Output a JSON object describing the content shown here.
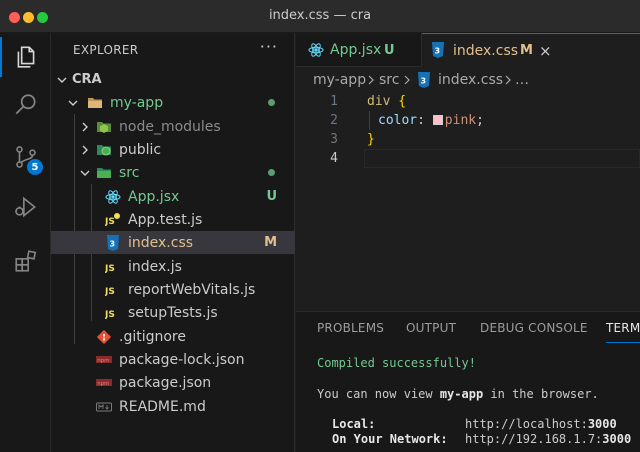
{
  "window": {
    "title": "index.css — cra"
  },
  "activity_bar": {
    "items": [
      {
        "name": "explorer",
        "icon": "files-icon",
        "active": true
      },
      {
        "name": "search",
        "icon": "search-icon"
      },
      {
        "name": "source-control",
        "icon": "source-control-icon",
        "badge": "5"
      },
      {
        "name": "run-debug",
        "icon": "debug-icon"
      },
      {
        "name": "extensions",
        "icon": "extensions-icon"
      }
    ]
  },
  "explorer": {
    "header": "EXPLORER",
    "more": "···",
    "workspace": "CRA",
    "tree": [
      {
        "label": "my-app",
        "icon": "folder-icon",
        "depth": 1,
        "expanded": true,
        "status": "dot"
      },
      {
        "label": "node_modules",
        "icon": "node-folder-icon",
        "depth": 2,
        "expanded": false
      },
      {
        "label": "public",
        "icon": "public-folder-icon",
        "depth": 2,
        "expanded": false
      },
      {
        "label": "src",
        "icon": "src-folder-icon",
        "depth": 2,
        "expanded": true,
        "status": "dot"
      },
      {
        "label": "App.jsx",
        "icon": "react-icon",
        "depth": 3,
        "status": "U"
      },
      {
        "label": "App.test.js",
        "icon": "js-test-icon",
        "depth": 3
      },
      {
        "label": "index.css",
        "icon": "css-icon",
        "depth": 3,
        "status": "M",
        "selected": true
      },
      {
        "label": "index.js",
        "icon": "js-icon",
        "depth": 3
      },
      {
        "label": "reportWebVitals.js",
        "icon": "js-icon",
        "depth": 3
      },
      {
        "label": "setupTests.js",
        "icon": "js-icon",
        "depth": 3
      },
      {
        "label": ".gitignore",
        "icon": "git-icon",
        "depth": 2
      },
      {
        "label": "package-lock.json",
        "icon": "npm-icon",
        "depth": 2
      },
      {
        "label": "package.json",
        "icon": "npm-icon",
        "depth": 2
      },
      {
        "label": "README.md",
        "icon": "markdown-icon",
        "depth": 2
      }
    ]
  },
  "tabs": [
    {
      "label": "App.jsx",
      "status": "U",
      "icon": "react-icon"
    },
    {
      "label": "index.css",
      "status": "M",
      "icon": "css-icon",
      "active": true,
      "close": "×"
    }
  ],
  "breadcrumbs": [
    "my-app",
    "src",
    "index.css",
    "…"
  ],
  "editor": {
    "line_numbers": [
      "1",
      "2",
      "3",
      "4"
    ],
    "code": {
      "l1_selector": "div",
      "l1_brace": " {",
      "l2_prop": "color",
      "l2_colon": ": ",
      "l2_value": "pink",
      "l2_semi": ";",
      "l3_brace": "}"
    },
    "swatch_color": "#ffc0cb"
  },
  "panel": {
    "tabs": [
      "PROBLEMS",
      "OUTPUT",
      "DEBUG CONSOLE",
      "TERM"
    ],
    "terminal": {
      "compiled": "Compiled successfully!",
      "view_pre": "You can now view ",
      "view_app": "my-app",
      "view_post": " in the browser.",
      "local_label": "Local:",
      "local_url_pre": "http://localhost:",
      "local_port": "3000",
      "network_label": "On Your Network:",
      "network_url_pre": "http://192.168.1.7:",
      "network_port": "3000"
    }
  },
  "colors": {
    "accent": "#0078d4",
    "untracked": "#73c991",
    "modified": "#e2c08d"
  }
}
